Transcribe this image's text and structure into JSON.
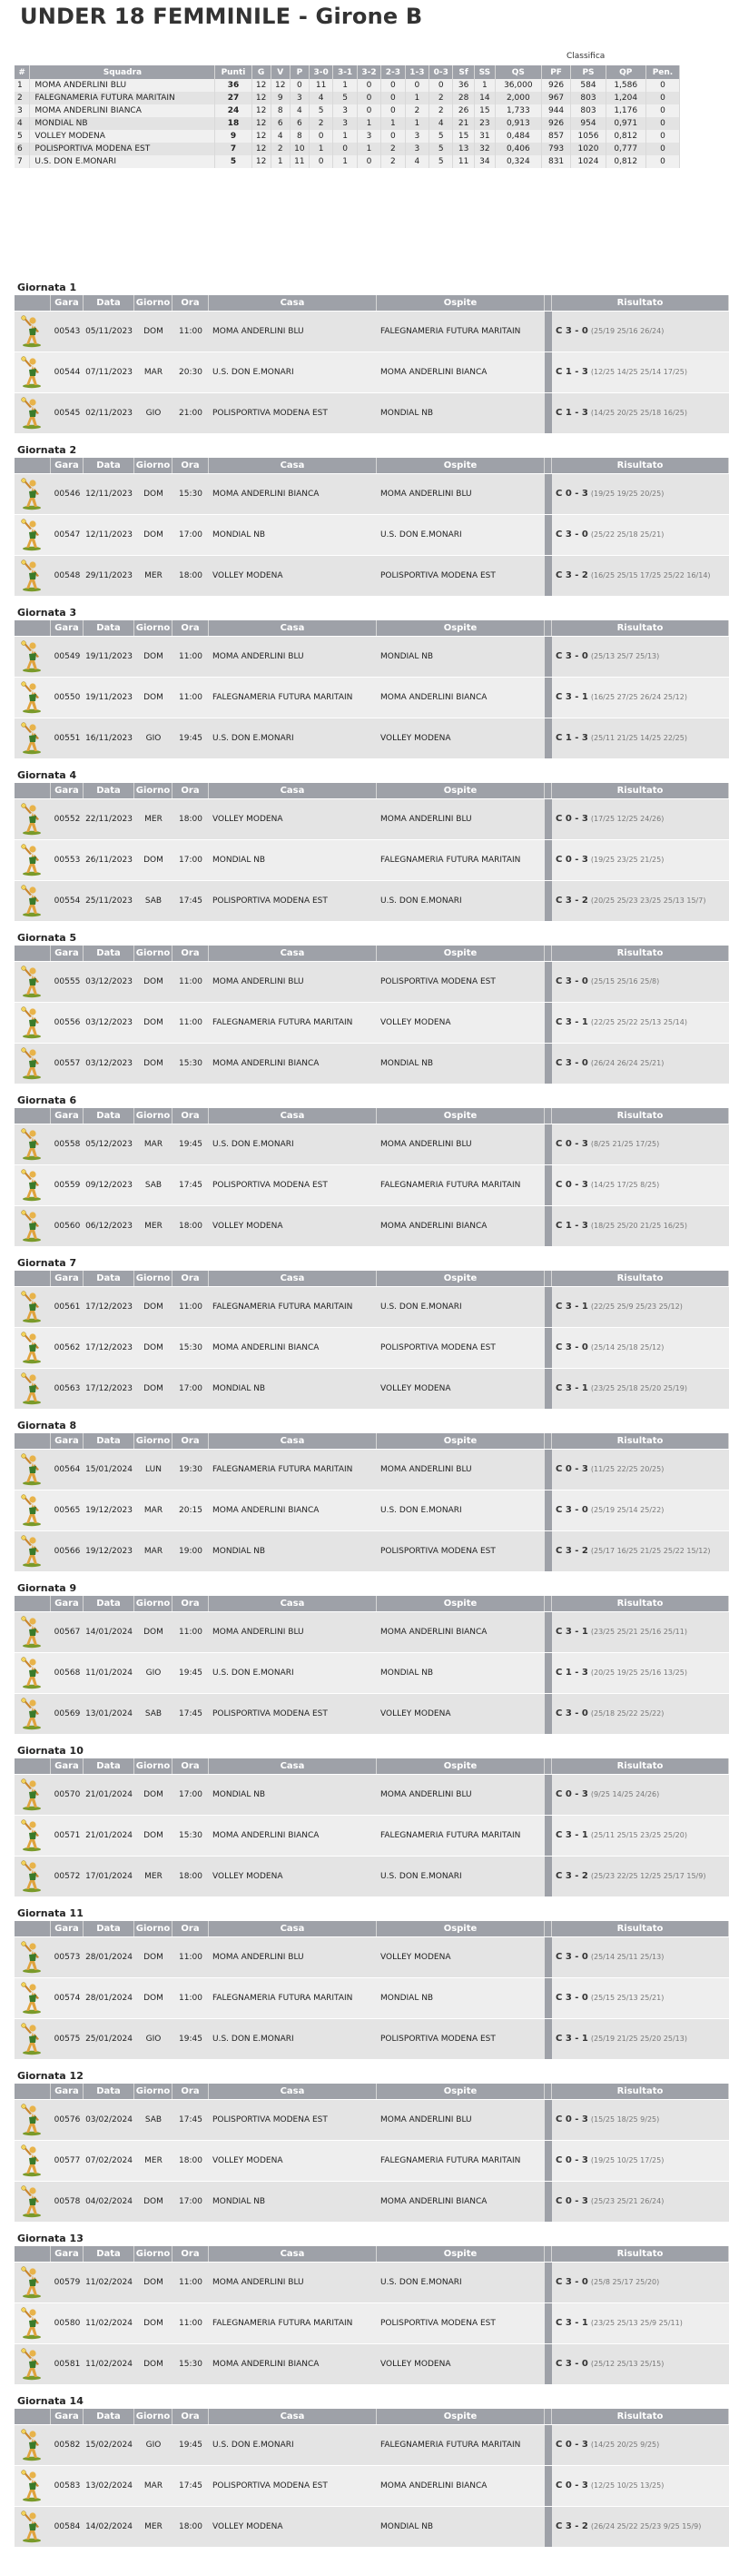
{
  "page_title": "UNDER 18 FEMMINILE - Girone B",
  "standings": {
    "caption": "Classifica",
    "columns": [
      "#",
      "Squadra",
      "Punti",
      "G",
      "V",
      "P",
      "3-0",
      "3-1",
      "3-2",
      "2-3",
      "1-3",
      "0-3",
      "Sf",
      "SS",
      "QS",
      "PF",
      "PS",
      "QP",
      "Pen."
    ],
    "rows": [
      [
        "1",
        "MOMA ANDERLINI BLU",
        "36",
        "12",
        "12",
        "0",
        "11",
        "1",
        "0",
        "0",
        "0",
        "0",
        "36",
        "1",
        "36,000",
        "926",
        "584",
        "1,586",
        "0"
      ],
      [
        "2",
        "FALEGNAMERIA FUTURA MARITAIN",
        "27",
        "12",
        "9",
        "3",
        "4",
        "5",
        "0",
        "0",
        "1",
        "2",
        "28",
        "14",
        "2,000",
        "967",
        "803",
        "1,204",
        "0"
      ],
      [
        "3",
        "MOMA ANDERLINI BIANCA",
        "24",
        "12",
        "8",
        "4",
        "5",
        "3",
        "0",
        "0",
        "2",
        "2",
        "26",
        "15",
        "1,733",
        "944",
        "803",
        "1,176",
        "0"
      ],
      [
        "4",
        "MONDIAL NB",
        "18",
        "12",
        "6",
        "6",
        "2",
        "3",
        "1",
        "1",
        "1",
        "4",
        "21",
        "23",
        "0,913",
        "926",
        "954",
        "0,971",
        "0"
      ],
      [
        "5",
        "VOLLEY MODENA",
        "9",
        "12",
        "4",
        "8",
        "0",
        "1",
        "3",
        "0",
        "3",
        "5",
        "15",
        "31",
        "0,484",
        "857",
        "1056",
        "0,812",
        "0"
      ],
      [
        "6",
        "POLISPORTIVA MODENA EST",
        "7",
        "12",
        "2",
        "10",
        "1",
        "0",
        "1",
        "2",
        "3",
        "5",
        "13",
        "32",
        "0,406",
        "793",
        "1020",
        "0,777",
        "0"
      ],
      [
        "7",
        "U.S. DON E.MONARI",
        "5",
        "12",
        "1",
        "11",
        "0",
        "1",
        "0",
        "2",
        "4",
        "5",
        "11",
        "34",
        "0,324",
        "831",
        "1024",
        "0,812",
        "0"
      ]
    ]
  },
  "match_columns": [
    "Gara",
    "Data",
    "Giorno",
    "Ora",
    "Casa",
    "Ospite",
    "Risultato"
  ],
  "icon": "volleyball-player-icon",
  "colors": {
    "header_bg": "#9ea1a8",
    "row_light": "#eeeeee",
    "row_dark": "#e4e4e4"
  },
  "rounds": [
    {
      "title": "Giornata 1",
      "matches": [
        {
          "gara": "00543",
          "data": "05/11/2023",
          "giorno": "DOM",
          "ora": "11:00",
          "casa": "MOMA ANDERLINI BLU",
          "ospite": "FALEGNAMERIA FUTURA MARITAIN",
          "risultato": "C 3 - 0",
          "sets": "(25/19 25/16 26/24)"
        },
        {
          "gara": "00544",
          "data": "07/11/2023",
          "giorno": "MAR",
          "ora": "20:30",
          "casa": "U.S. DON E.MONARI",
          "ospite": "MOMA ANDERLINI BIANCA",
          "risultato": "C 1 - 3",
          "sets": "(12/25 14/25 25/14 17/25)"
        },
        {
          "gara": "00545",
          "data": "02/11/2023",
          "giorno": "GIO",
          "ora": "21:00",
          "casa": "POLISPORTIVA MODENA EST",
          "ospite": "MONDIAL NB",
          "risultato": "C 1 - 3",
          "sets": "(14/25 20/25 25/18 16/25)"
        }
      ]
    },
    {
      "title": "Giornata 2",
      "matches": [
        {
          "gara": "00546",
          "data": "12/11/2023",
          "giorno": "DOM",
          "ora": "15:30",
          "casa": "MOMA ANDERLINI BIANCA",
          "ospite": "MOMA ANDERLINI BLU",
          "risultato": "C 0 - 3",
          "sets": "(19/25 19/25 20/25)"
        },
        {
          "gara": "00547",
          "data": "12/11/2023",
          "giorno": "DOM",
          "ora": "17:00",
          "casa": "MONDIAL NB",
          "ospite": "U.S. DON E.MONARI",
          "risultato": "C 3 - 0",
          "sets": "(25/22 25/18 25/21)"
        },
        {
          "gara": "00548",
          "data": "29/11/2023",
          "giorno": "MER",
          "ora": "18:00",
          "casa": "VOLLEY MODENA",
          "ospite": "POLISPORTIVA MODENA EST",
          "risultato": "C 3 - 2",
          "sets": "(16/25 25/15 17/25 25/22 16/14)"
        }
      ]
    },
    {
      "title": "Giornata 3",
      "matches": [
        {
          "gara": "00549",
          "data": "19/11/2023",
          "giorno": "DOM",
          "ora": "11:00",
          "casa": "MOMA ANDERLINI BLU",
          "ospite": "MONDIAL NB",
          "risultato": "C 3 - 0",
          "sets": "(25/13 25/7 25/13)"
        },
        {
          "gara": "00550",
          "data": "19/11/2023",
          "giorno": "DOM",
          "ora": "11:00",
          "casa": "FALEGNAMERIA FUTURA MARITAIN",
          "ospite": "MOMA ANDERLINI BIANCA",
          "risultato": "C 3 - 1",
          "sets": "(16/25 27/25 26/24 25/12)"
        },
        {
          "gara": "00551",
          "data": "16/11/2023",
          "giorno": "GIO",
          "ora": "19:45",
          "casa": "U.S. DON E.MONARI",
          "ospite": "VOLLEY MODENA",
          "risultato": "C 1 - 3",
          "sets": "(25/11 21/25 14/25 22/25)"
        }
      ]
    },
    {
      "title": "Giornata 4",
      "matches": [
        {
          "gara": "00552",
          "data": "22/11/2023",
          "giorno": "MER",
          "ora": "18:00",
          "casa": "VOLLEY MODENA",
          "ospite": "MOMA ANDERLINI BLU",
          "risultato": "C 0 - 3",
          "sets": "(17/25 12/25 24/26)"
        },
        {
          "gara": "00553",
          "data": "26/11/2023",
          "giorno": "DOM",
          "ora": "17:00",
          "casa": "MONDIAL NB",
          "ospite": "FALEGNAMERIA FUTURA MARITAIN",
          "risultato": "C 0 - 3",
          "sets": "(19/25 23/25 21/25)"
        },
        {
          "gara": "00554",
          "data": "25/11/2023",
          "giorno": "SAB",
          "ora": "17:45",
          "casa": "POLISPORTIVA MODENA EST",
          "ospite": "U.S. DON E.MONARI",
          "risultato": "C 3 - 2",
          "sets": "(20/25 25/23 23/25 25/13 15/7)"
        }
      ]
    },
    {
      "title": "Giornata 5",
      "matches": [
        {
          "gara": "00555",
          "data": "03/12/2023",
          "giorno": "DOM",
          "ora": "11:00",
          "casa": "MOMA ANDERLINI BLU",
          "ospite": "POLISPORTIVA MODENA EST",
          "risultato": "C 3 - 0",
          "sets": "(25/15 25/16 25/8)"
        },
        {
          "gara": "00556",
          "data": "03/12/2023",
          "giorno": "DOM",
          "ora": "11:00",
          "casa": "FALEGNAMERIA FUTURA MARITAIN",
          "ospite": "VOLLEY MODENA",
          "risultato": "C 3 - 1",
          "sets": "(22/25 25/22 25/13 25/14)"
        },
        {
          "gara": "00557",
          "data": "03/12/2023",
          "giorno": "DOM",
          "ora": "15:30",
          "casa": "MOMA ANDERLINI BIANCA",
          "ospite": "MONDIAL NB",
          "risultato": "C 3 - 0",
          "sets": "(26/24 26/24 25/21)"
        }
      ]
    },
    {
      "title": "Giornata 6",
      "matches": [
        {
          "gara": "00558",
          "data": "05/12/2023",
          "giorno": "MAR",
          "ora": "19:45",
          "casa": "U.S. DON E.MONARI",
          "ospite": "MOMA ANDERLINI BLU",
          "risultato": "C 0 - 3",
          "sets": "(8/25 21/25 17/25)"
        },
        {
          "gara": "00559",
          "data": "09/12/2023",
          "giorno": "SAB",
          "ora": "17:45",
          "casa": "POLISPORTIVA MODENA EST",
          "ospite": "FALEGNAMERIA FUTURA MARITAIN",
          "risultato": "C 0 - 3",
          "sets": "(14/25 17/25 8/25)"
        },
        {
          "gara": "00560",
          "data": "06/12/2023",
          "giorno": "MER",
          "ora": "18:00",
          "casa": "VOLLEY MODENA",
          "ospite": "MOMA ANDERLINI BIANCA",
          "risultato": "C 1 - 3",
          "sets": "(18/25 25/20 21/25 16/25)"
        }
      ]
    },
    {
      "title": "Giornata 7",
      "matches": [
        {
          "gara": "00561",
          "data": "17/12/2023",
          "giorno": "DOM",
          "ora": "11:00",
          "casa": "FALEGNAMERIA FUTURA MARITAIN",
          "ospite": "U.S. DON E.MONARI",
          "risultato": "C 3 - 1",
          "sets": "(22/25 25/9 25/23 25/12)"
        },
        {
          "gara": "00562",
          "data": "17/12/2023",
          "giorno": "DOM",
          "ora": "15:30",
          "casa": "MOMA ANDERLINI BIANCA",
          "ospite": "POLISPORTIVA MODENA EST",
          "risultato": "C 3 - 0",
          "sets": "(25/14 25/18 25/12)"
        },
        {
          "gara": "00563",
          "data": "17/12/2023",
          "giorno": "DOM",
          "ora": "17:00",
          "casa": "MONDIAL NB",
          "ospite": "VOLLEY MODENA",
          "risultato": "C 3 - 1",
          "sets": "(23/25 25/18 25/20 25/19)"
        }
      ]
    },
    {
      "title": "Giornata 8",
      "matches": [
        {
          "gara": "00564",
          "data": "15/01/2024",
          "giorno": "LUN",
          "ora": "19:30",
          "casa": "FALEGNAMERIA FUTURA MARITAIN",
          "ospite": "MOMA ANDERLINI BLU",
          "risultato": "C 0 - 3",
          "sets": "(11/25 22/25 20/25)"
        },
        {
          "gara": "00565",
          "data": "19/12/2023",
          "giorno": "MAR",
          "ora": "20:15",
          "casa": "MOMA ANDERLINI BIANCA",
          "ospite": "U.S. DON E.MONARI",
          "risultato": "C 3 - 0",
          "sets": "(25/19 25/14 25/22)"
        },
        {
          "gara": "00566",
          "data": "19/12/2023",
          "giorno": "MAR",
          "ora": "19:00",
          "casa": "MONDIAL NB",
          "ospite": "POLISPORTIVA MODENA EST",
          "risultato": "C 3 - 2",
          "sets": "(25/17 16/25 21/25 25/22 15/12)"
        }
      ]
    },
    {
      "title": "Giornata 9",
      "matches": [
        {
          "gara": "00567",
          "data": "14/01/2024",
          "giorno": "DOM",
          "ora": "11:00",
          "casa": "MOMA ANDERLINI BLU",
          "ospite": "MOMA ANDERLINI BIANCA",
          "risultato": "C 3 - 1",
          "sets": "(23/25 25/21 25/16 25/11)"
        },
        {
          "gara": "00568",
          "data": "11/01/2024",
          "giorno": "GIO",
          "ora": "19:45",
          "casa": "U.S. DON E.MONARI",
          "ospite": "MONDIAL NB",
          "risultato": "C 1 - 3",
          "sets": "(20/25 19/25 25/16 13/25)"
        },
        {
          "gara": "00569",
          "data": "13/01/2024",
          "giorno": "SAB",
          "ora": "17:45",
          "casa": "POLISPORTIVA MODENA EST",
          "ospite": "VOLLEY MODENA",
          "risultato": "C 3 - 0",
          "sets": "(25/18 25/22 25/22)"
        }
      ]
    },
    {
      "title": "Giornata 10",
      "matches": [
        {
          "gara": "00570",
          "data": "21/01/2024",
          "giorno": "DOM",
          "ora": "17:00",
          "casa": "MONDIAL NB",
          "ospite": "MOMA ANDERLINI BLU",
          "risultato": "C 0 - 3",
          "sets": "(9/25 14/25 24/26)"
        },
        {
          "gara": "00571",
          "data": "21/01/2024",
          "giorno": "DOM",
          "ora": "15:30",
          "casa": "MOMA ANDERLINI BIANCA",
          "ospite": "FALEGNAMERIA FUTURA MARITAIN",
          "risultato": "C 3 - 1",
          "sets": "(25/11 25/15 23/25 25/20)"
        },
        {
          "gara": "00572",
          "data": "17/01/2024",
          "giorno": "MER",
          "ora": "18:00",
          "casa": "VOLLEY MODENA",
          "ospite": "U.S. DON E.MONARI",
          "risultato": "C 3 - 2",
          "sets": "(25/23 22/25 12/25 25/17 15/9)"
        }
      ]
    },
    {
      "title": "Giornata 11",
      "matches": [
        {
          "gara": "00573",
          "data": "28/01/2024",
          "giorno": "DOM",
          "ora": "11:00",
          "casa": "MOMA ANDERLINI BLU",
          "ospite": "VOLLEY MODENA",
          "risultato": "C 3 - 0",
          "sets": "(25/14 25/11 25/13)"
        },
        {
          "gara": "00574",
          "data": "28/01/2024",
          "giorno": "DOM",
          "ora": "11:00",
          "casa": "FALEGNAMERIA FUTURA MARITAIN",
          "ospite": "MONDIAL NB",
          "risultato": "C 3 - 0",
          "sets": "(25/15 25/13 25/21)"
        },
        {
          "gara": "00575",
          "data": "25/01/2024",
          "giorno": "GIO",
          "ora": "19:45",
          "casa": "U.S. DON E.MONARI",
          "ospite": "POLISPORTIVA MODENA EST",
          "risultato": "C 3 - 1",
          "sets": "(25/19 21/25 25/20 25/13)"
        }
      ]
    },
    {
      "title": "Giornata 12",
      "matches": [
        {
          "gara": "00576",
          "data": "03/02/2024",
          "giorno": "SAB",
          "ora": "17:45",
          "casa": "POLISPORTIVA MODENA EST",
          "ospite": "MOMA ANDERLINI BLU",
          "risultato": "C 0 - 3",
          "sets": "(15/25 18/25 9/25)"
        },
        {
          "gara": "00577",
          "data": "07/02/2024",
          "giorno": "MER",
          "ora": "18:00",
          "casa": "VOLLEY MODENA",
          "ospite": "FALEGNAMERIA FUTURA MARITAIN",
          "risultato": "C 0 - 3",
          "sets": "(19/25 10/25 17/25)"
        },
        {
          "gara": "00578",
          "data": "04/02/2024",
          "giorno": "DOM",
          "ora": "17:00",
          "casa": "MONDIAL NB",
          "ospite": "MOMA ANDERLINI BIANCA",
          "risultato": "C 0 - 3",
          "sets": "(25/23 25/21 26/24)"
        }
      ]
    },
    {
      "title": "Giornata 13",
      "matches": [
        {
          "gara": "00579",
          "data": "11/02/2024",
          "giorno": "DOM",
          "ora": "11:00",
          "casa": "MOMA ANDERLINI BLU",
          "ospite": "U.S. DON E.MONARI",
          "risultato": "C 3 - 0",
          "sets": "(25/8 25/17 25/20)"
        },
        {
          "gara": "00580",
          "data": "11/02/2024",
          "giorno": "DOM",
          "ora": "11:00",
          "casa": "FALEGNAMERIA FUTURA MARITAIN",
          "ospite": "POLISPORTIVA MODENA EST",
          "risultato": "C 3 - 1",
          "sets": "(23/25 25/13 25/9 25/11)"
        },
        {
          "gara": "00581",
          "data": "11/02/2024",
          "giorno": "DOM",
          "ora": "15:30",
          "casa": "MOMA ANDERLINI BIANCA",
          "ospite": "VOLLEY MODENA",
          "risultato": "C 3 - 0",
          "sets": "(25/12 25/13 25/15)"
        }
      ]
    },
    {
      "title": "Giornata 14",
      "matches": [
        {
          "gara": "00582",
          "data": "15/02/2024",
          "giorno": "GIO",
          "ora": "19:45",
          "casa": "U.S. DON E.MONARI",
          "ospite": "FALEGNAMERIA FUTURA MARITAIN",
          "risultato": "C 0 - 3",
          "sets": "(14/25 20/25 9/25)"
        },
        {
          "gara": "00583",
          "data": "13/02/2024",
          "giorno": "MAR",
          "ora": "17:45",
          "casa": "POLISPORTIVA MODENA EST",
          "ospite": "MOMA ANDERLINI BIANCA",
          "risultato": "C 0 - 3",
          "sets": "(12/25 10/25 13/25)"
        },
        {
          "gara": "00584",
          "data": "14/02/2024",
          "giorno": "MER",
          "ora": "18:00",
          "casa": "VOLLEY MODENA",
          "ospite": "MONDIAL NB",
          "risultato": "C 3 - 2",
          "sets": "(26/24 25/22 25/23 9/25 15/9)"
        }
      ]
    }
  ]
}
